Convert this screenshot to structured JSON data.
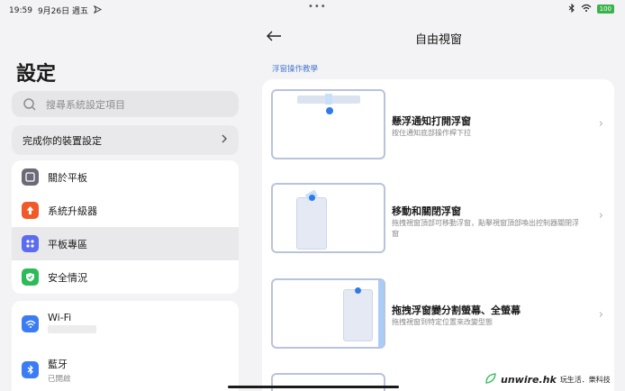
{
  "status_bar": {
    "time": "19:59",
    "date": "9月26日 週五",
    "battery": "100"
  },
  "settings": {
    "title": "設定",
    "search_placeholder": "搜尋系統設定項目",
    "complete_setup": "完成你的裝置設定",
    "items": [
      {
        "label": "關於平板",
        "icon": "tablet-icon",
        "color": "#6a6a78"
      },
      {
        "label": "系統升級器",
        "icon": "upgrade-arrow-icon",
        "color": "#f05a28"
      },
      {
        "label": "平板專區",
        "icon": "grid-dots-icon",
        "color": "#5b6cf0"
      },
      {
        "label": "安全情況",
        "icon": "shield-check-icon",
        "color": "#2dbb59"
      }
    ],
    "connections": [
      {
        "label": "Wi-Fi",
        "sub": "",
        "icon": "wifi-icon",
        "color": "#3b7cf5"
      },
      {
        "label": "藍牙",
        "sub": "已開啟",
        "icon": "bluetooth-icon",
        "color": "#3b7cf5"
      }
    ]
  },
  "freeform": {
    "title": "自由視窗",
    "section": "浮窗操作教學",
    "rows": [
      {
        "title": "懸浮通知打開浮窗",
        "desc": "按住通知底部操作桿下拉"
      },
      {
        "title": "移動和關閉浮窗",
        "desc": "拖拽視窗頂部可移動浮窗，點擊視窗頂部喚出控制器關閉浮窗"
      },
      {
        "title": "拖拽浮窗變分割螢幕、全螢幕",
        "desc": "拖拽視窗到特定位置來改變型態"
      }
    ]
  },
  "watermark": {
    "brand": "unwire.hk",
    "tagline": "玩生活．樂科技"
  },
  "colors": {
    "accent": "#4a7ad0",
    "thumb_border": "#b8c3dc",
    "dot": "#2f7be6"
  }
}
